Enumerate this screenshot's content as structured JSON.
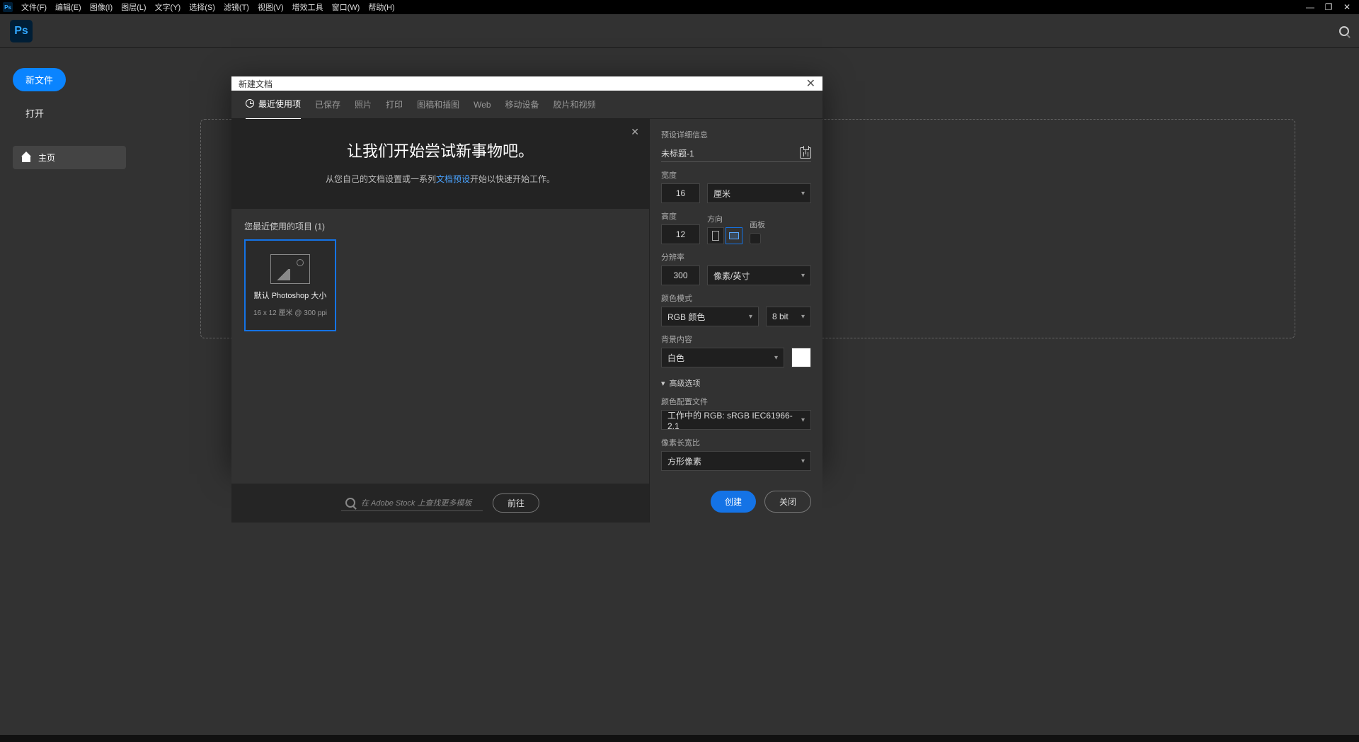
{
  "menubar": {
    "items": [
      "文件(F)",
      "编辑(E)",
      "图像(I)",
      "图层(L)",
      "文字(Y)",
      "选择(S)",
      "滤镜(T)",
      "视图(V)",
      "增效工具",
      "窗口(W)",
      "帮助(H)"
    ]
  },
  "left": {
    "new": "新文件",
    "open": "打开",
    "home": "主页"
  },
  "dialog": {
    "title": "新建文档",
    "tabs": [
      "最近使用项",
      "已保存",
      "照片",
      "打印",
      "图稿和插图",
      "Web",
      "移动设备",
      "胶片和视频"
    ],
    "hero_title": "让我们开始尝试新事物吧。",
    "hero_text_pre": "从您自己的文档设置或一系列",
    "hero_link": "文档预设",
    "hero_text_post": "开始以快速开始工作。",
    "recent_label": "您最近使用的项目 (1)",
    "preset_name": "默认 Photoshop 大小",
    "preset_meta": "16 x 12 厘米 @ 300 ppi",
    "search_placeholder": "在 Adobe Stock 上查找更多模板",
    "go": "前往",
    "create": "创建",
    "close": "关闭"
  },
  "details": {
    "heading": "预设详细信息",
    "name": "未标题-1",
    "width_label": "宽度",
    "width": "16",
    "unit": "厘米",
    "height_label": "高度",
    "height": "12",
    "orientation_label": "方向",
    "artboard_label": "画板",
    "res_label": "分辨率",
    "res": "300",
    "res_unit": "像素/英寸",
    "color_label": "颜色模式",
    "color_mode": "RGB 颜色",
    "bit": "8 bit",
    "bg_label": "背景内容",
    "bg": "白色",
    "advanced": "高级选项",
    "profile_label": "颜色配置文件",
    "profile": "工作中的 RGB: sRGB IEC61966-2.1",
    "aspect_label": "像素长宽比",
    "aspect": "方形像素"
  }
}
